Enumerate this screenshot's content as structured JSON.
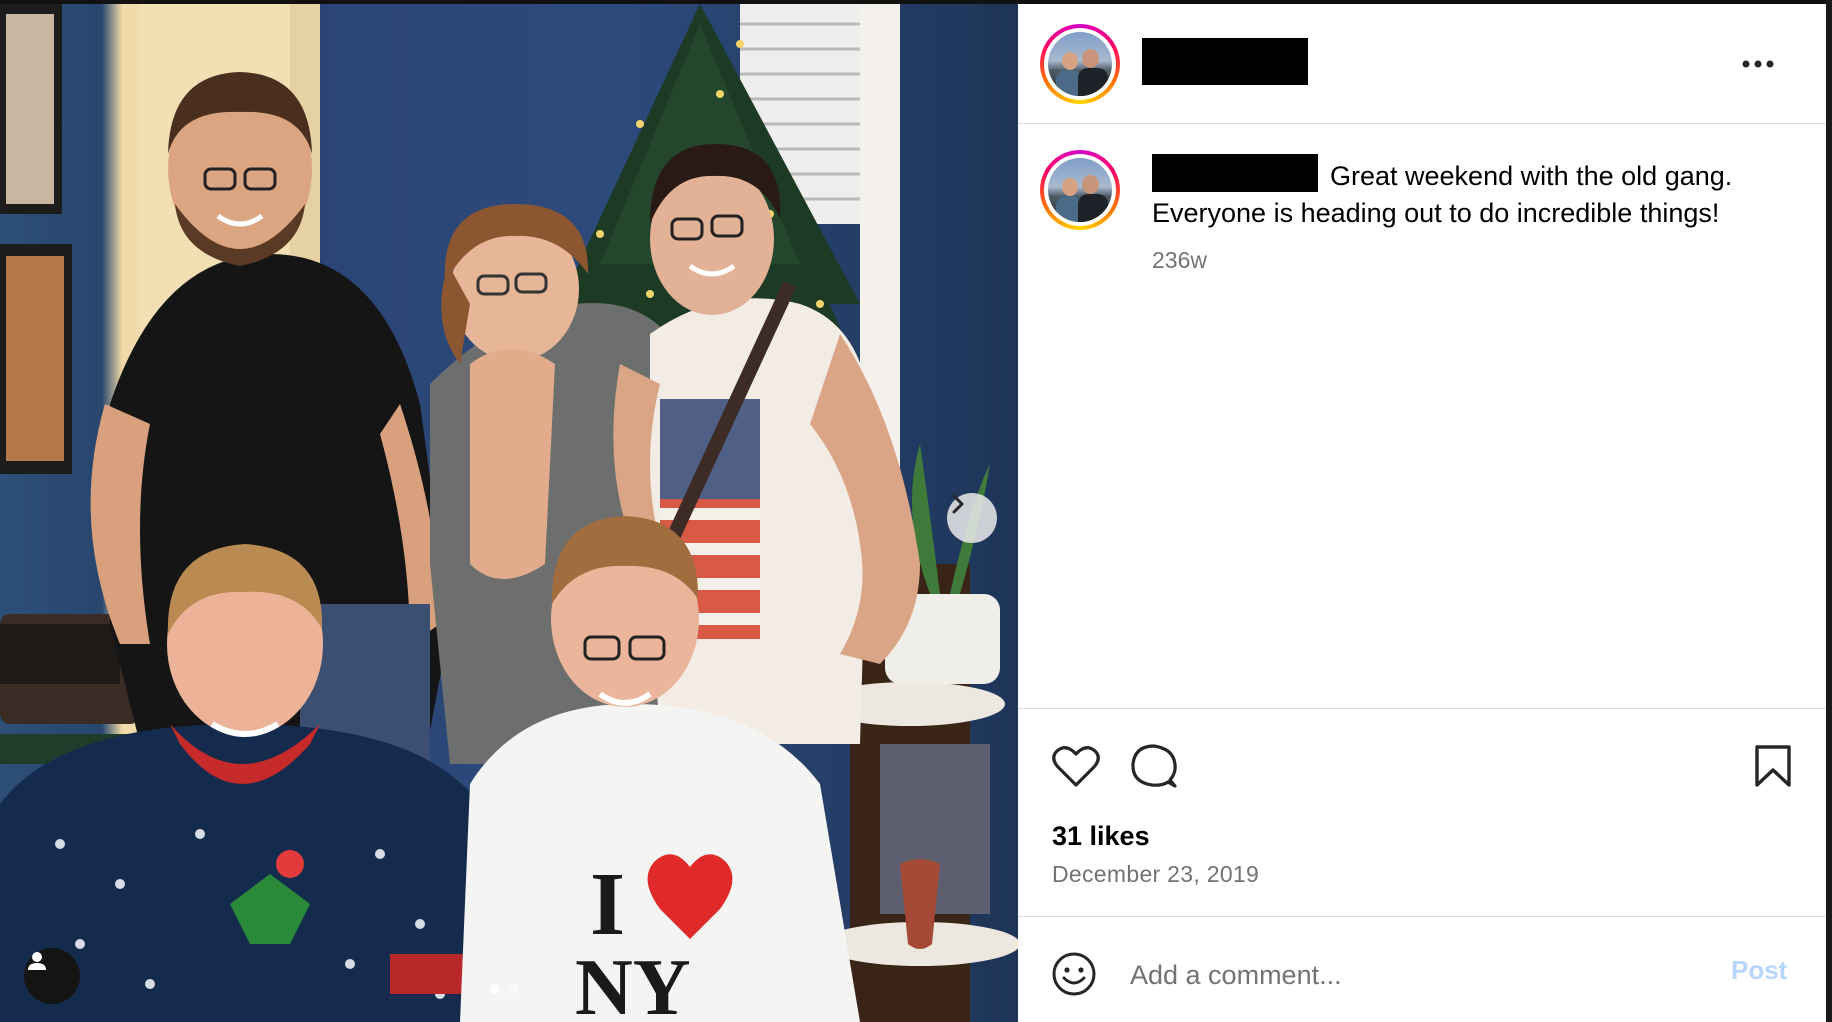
{
  "post": {
    "username_redacted": true,
    "caption": "Great weekend with the old gang. Everyone is heading out to do incredible things!",
    "age": "236w",
    "likes": "31 likes",
    "date": "December 23, 2019"
  },
  "photo": {
    "carousel_total": 2,
    "carousel_index": 1
  },
  "comment_box": {
    "placeholder": "Add a comment...",
    "post_label": "Post"
  },
  "icons": {
    "more": "more-horizontal-icon",
    "like": "heart-icon",
    "comment": "comment-icon",
    "save": "bookmark-icon",
    "emoji": "smiley-icon",
    "next": "chevron-right-icon",
    "tag": "user-icon"
  },
  "colors": {
    "post_button_disabled": "#b7d6fb",
    "secondary_text": "#737373",
    "divider": "#dbdbdb"
  }
}
